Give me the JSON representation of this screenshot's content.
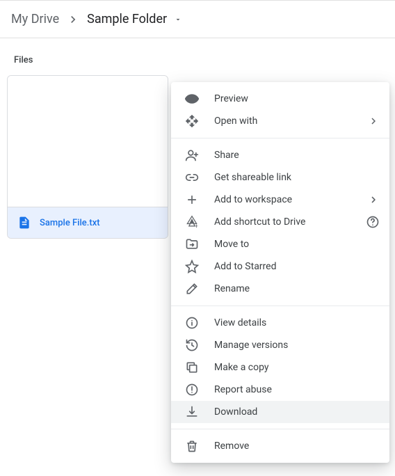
{
  "breadcrumb": {
    "root": "My Drive",
    "current": "Sample Folder"
  },
  "sections": {
    "files_label": "Files"
  },
  "file": {
    "name": "Sample File.txt"
  },
  "menu": {
    "preview": "Preview",
    "open_with": "Open with",
    "share": "Share",
    "shareable_link": "Get shareable link",
    "add_workspace": "Add to workspace",
    "add_shortcut": "Add shortcut to Drive",
    "move_to": "Move to",
    "add_starred": "Add to Starred",
    "rename": "Rename",
    "view_details": "View details",
    "manage_versions": "Manage versions",
    "make_copy": "Make a copy",
    "report_abuse": "Report abuse",
    "download": "Download",
    "remove": "Remove"
  }
}
